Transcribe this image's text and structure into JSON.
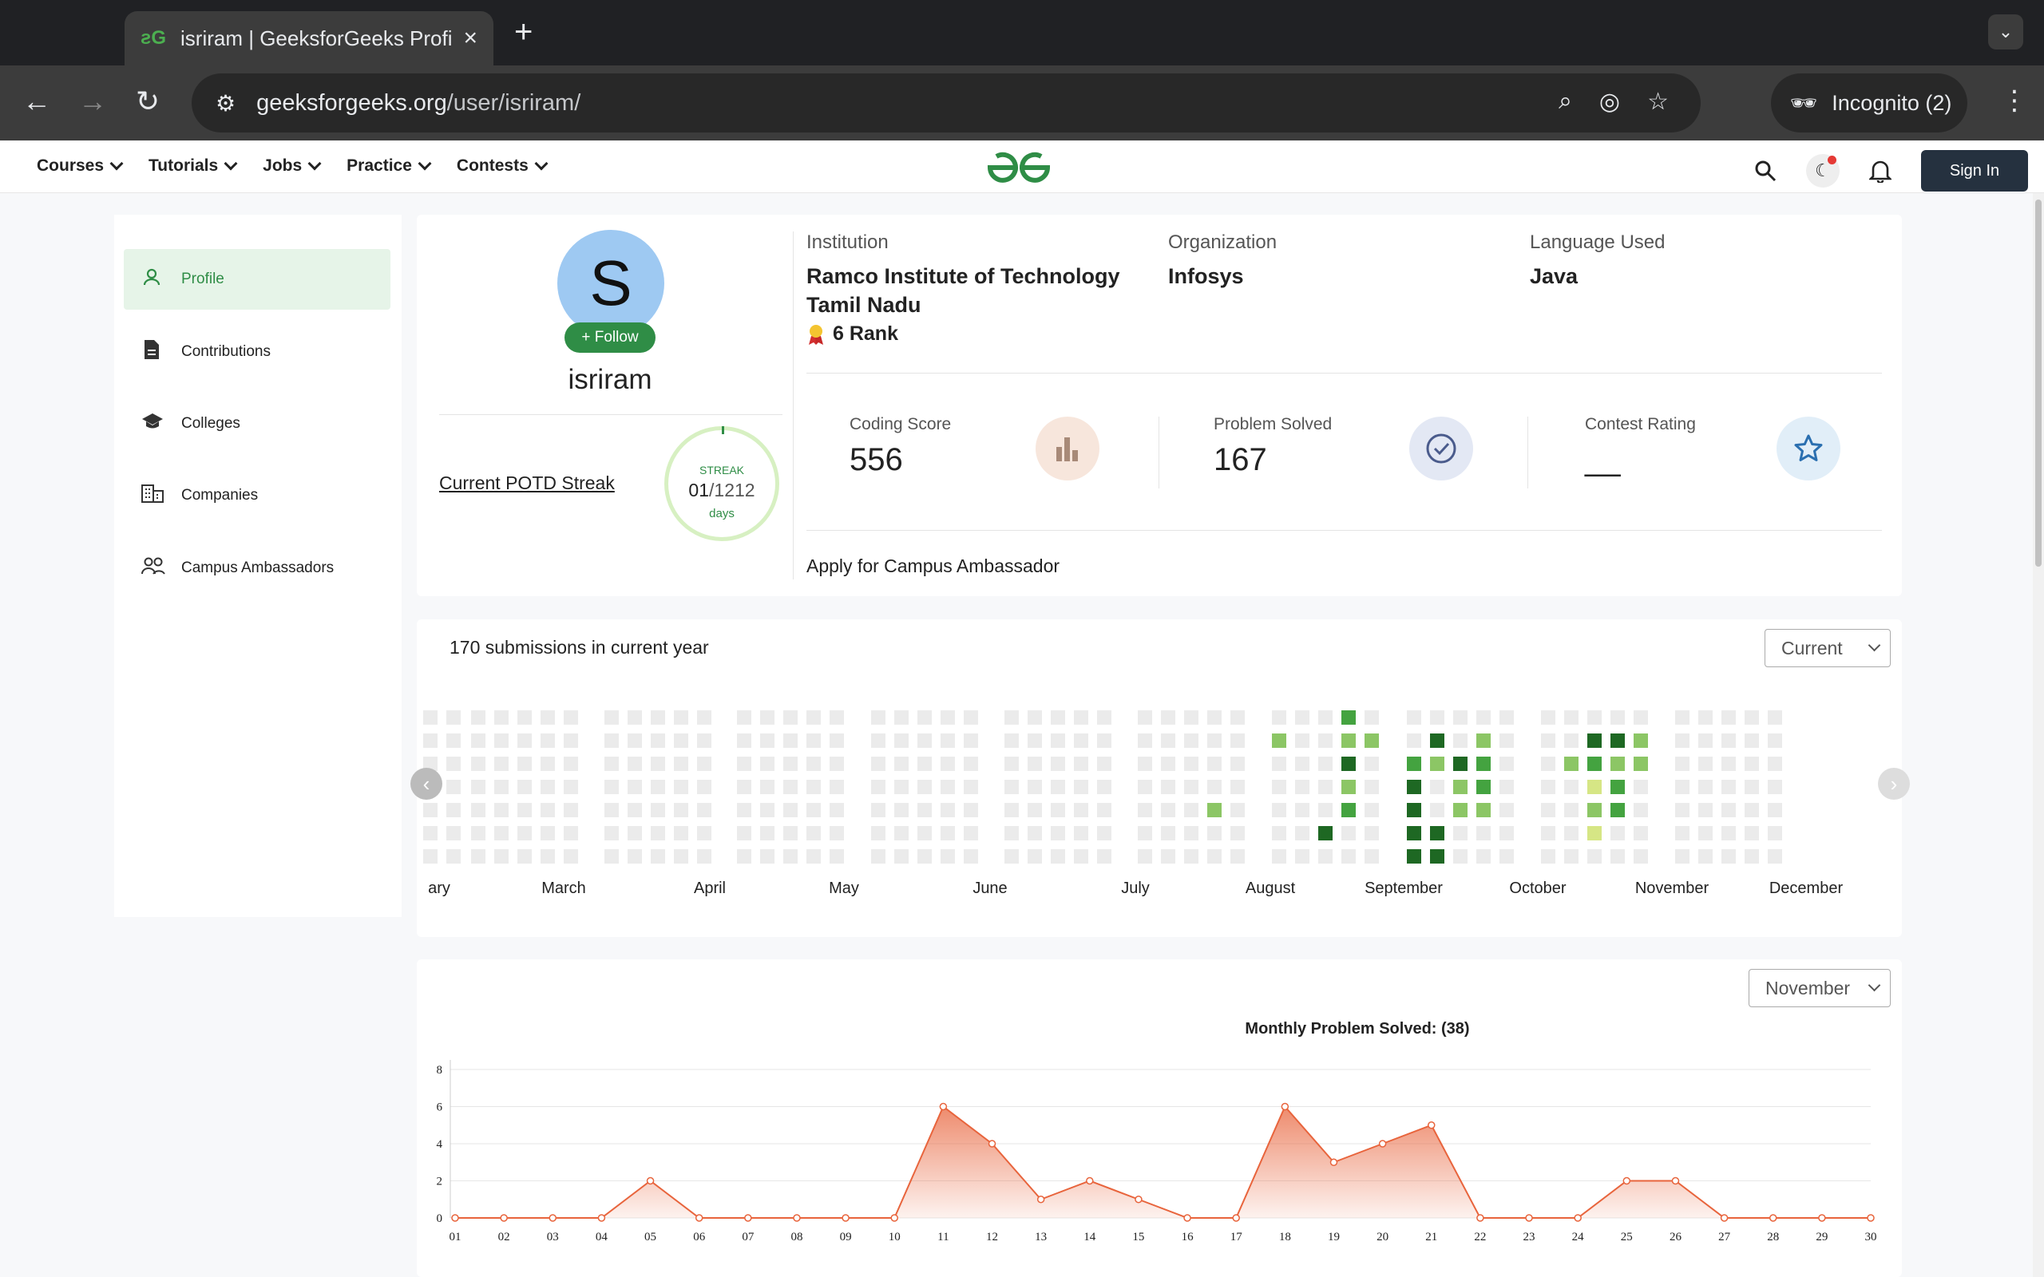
{
  "browser": {
    "tab_title": "isriram | GeeksforGeeks Profil",
    "url_host": "geeksforgeeks.org",
    "url_path": "/user/isriram/",
    "incognito_label": "Incognito (2)"
  },
  "gfg_nav": {
    "menu": [
      "Courses",
      "Tutorials",
      "Jobs",
      "Practice",
      "Contests"
    ],
    "sign_in": "Sign In"
  },
  "sidebar": {
    "items": [
      {
        "label": "Profile",
        "icon": "user-icon"
      },
      {
        "label": "Contributions",
        "icon": "document-icon"
      },
      {
        "label": "Colleges",
        "icon": "graduation-cap-icon"
      },
      {
        "label": "Companies",
        "icon": "building-icon"
      },
      {
        "label": "Campus Ambassadors",
        "icon": "people-icon"
      }
    ]
  },
  "profile": {
    "avatar_letter": "S",
    "follow_label": "+ Follow",
    "username": "isriram",
    "potd_label": "Current POTD Streak",
    "streak_label": "STREAK",
    "streak_current": "01",
    "streak_total": "/1212",
    "streak_unit": "days",
    "institution_label": "Institution",
    "institution": "Ramco Institute of Technology Tamil Nadu",
    "rank": "6 Rank",
    "organization_label": "Organization",
    "organization": "Infosys",
    "language_label": "Language Used",
    "language": "Java",
    "coding_score_label": "Coding Score",
    "coding_score": "556",
    "problems_solved_label": "Problem Solved",
    "problems_solved": "167",
    "contest_rating_label": "Contest Rating",
    "contest_rating": "__",
    "apply_label": "Apply for Campus Ambassador"
  },
  "submissions": {
    "title": "170 submissions in current year",
    "year_select": "Current",
    "months": [
      "ary",
      "March",
      "April",
      "May",
      "June",
      "July",
      "August",
      "September",
      "October",
      "November",
      "December"
    ]
  },
  "colors": {
    "brand_green": "#2f8d46",
    "chart_orange": "#e8643c",
    "hm_empty": "#ebebeb",
    "hm_l1": "#d6e685",
    "hm_l2": "#8cc665",
    "hm_l3": "#44a340",
    "hm_l4": "#1e6823"
  },
  "monthly_chart_select": "November",
  "chart_data": {
    "type": "area",
    "title": "Monthly Problem Solved: (38)",
    "xlabel": "",
    "ylabel": "",
    "x": [
      "01",
      "02",
      "03",
      "04",
      "05",
      "06",
      "07",
      "08",
      "09",
      "10",
      "11",
      "12",
      "13",
      "14",
      "15",
      "16",
      "17",
      "18",
      "19",
      "20",
      "21",
      "22",
      "23",
      "24",
      "25",
      "26",
      "27",
      "28",
      "29",
      "30"
    ],
    "series": [
      {
        "values": [
          0,
          0,
          0,
          0,
          2,
          0,
          0,
          0,
          0,
          0,
          6,
          4,
          1,
          2,
          1,
          0,
          0,
          6,
          3,
          4,
          5,
          0,
          0,
          0,
          2,
          2,
          0,
          0,
          0,
          0
        ]
      }
    ],
    "ylim": [
      0,
      8
    ],
    "yticks": [
      0,
      2,
      4,
      6,
      8
    ],
    "grid": true
  }
}
